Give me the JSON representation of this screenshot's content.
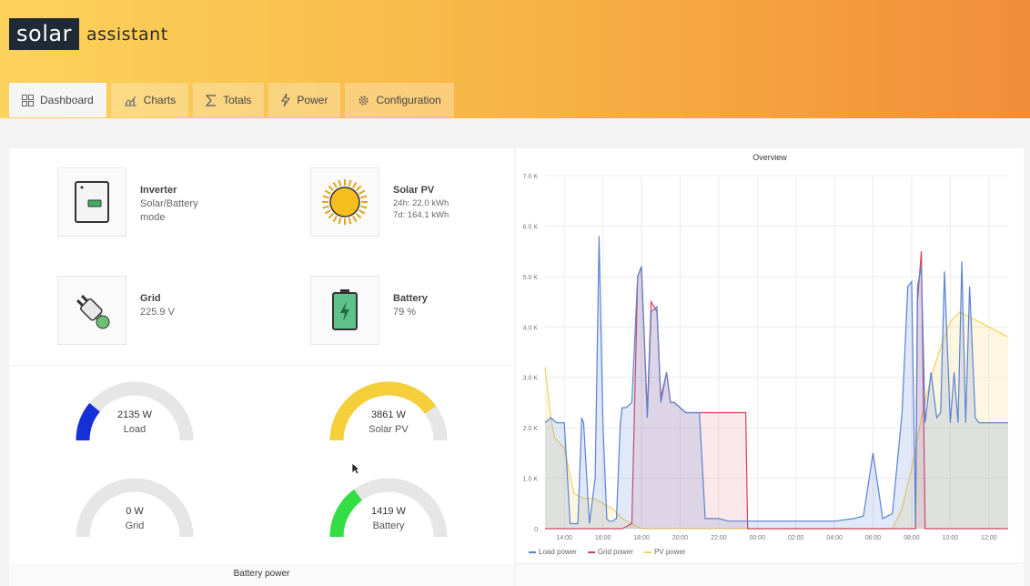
{
  "app": {
    "logo_box": "solar",
    "logo_text": "assistant"
  },
  "tabs": [
    {
      "label": "Dashboard",
      "icon": "grid-icon",
      "active": true
    },
    {
      "label": "Charts",
      "icon": "chart-icon"
    },
    {
      "label": "Totals",
      "icon": "sigma-icon"
    },
    {
      "label": "Power",
      "icon": "bolt-icon"
    },
    {
      "label": "Configuration",
      "icon": "gear-icon"
    }
  ],
  "devices": {
    "inverter": {
      "name": "Inverter",
      "line1": "Solar/Battery",
      "line2": "mode"
    },
    "solar": {
      "name": "Solar PV",
      "line1": "24h: 22.0 kWh",
      "line2": "7d: 164.1 kWh"
    },
    "grid": {
      "name": "Grid",
      "line1": "225.9 V"
    },
    "battery": {
      "name": "Battery",
      "line1": "79 %"
    }
  },
  "gauges": {
    "load": {
      "value": "2135 W",
      "label": "Load",
      "fraction": 0.22,
      "color": "#1530d6"
    },
    "solar": {
      "value": "3861 W",
      "label": "Solar PV",
      "fraction": 0.8,
      "color": "#f4cf3a"
    },
    "grid": {
      "value": "0 W",
      "label": "Grid",
      "fraction": 0.0,
      "color": "#1530d6"
    },
    "battery": {
      "value": "1419 W",
      "label": "Battery",
      "fraction": 0.3,
      "color": "#33dd44"
    }
  },
  "footer": {
    "battery_power_title": "Battery power"
  },
  "colors": {
    "load": "#5a82d0",
    "grid": "#d9405a",
    "pv": "#f2d25e"
  },
  "chart_data": {
    "type": "area",
    "title": "Overview",
    "x_tick_labels": [
      "14:00",
      "16:00",
      "18:00",
      "20:00",
      "22:00",
      "00:00",
      "02:00",
      "04:00",
      "06:00",
      "08:00",
      "10:00",
      "12:00"
    ],
    "y_tick_labels": [
      "0",
      "1.0 K",
      "2.0 K",
      "3.0 K",
      "4.0 K",
      "5.0 K",
      "6.0 K",
      "7.0 K"
    ],
    "ylim": [
      0,
      7000
    ],
    "xlim_hours": [
      13.0,
      37.0
    ],
    "legend": [
      "Load power",
      "Grid power",
      "PV power"
    ],
    "legend_position": "bottom-left",
    "grid": true,
    "series": [
      {
        "name": "Load power",
        "x": [
          13.0,
          13.3,
          13.6,
          14.0,
          14.3,
          14.5,
          14.7,
          14.9,
          15.0,
          15.3,
          15.6,
          15.8,
          16.0,
          16.2,
          16.3,
          16.5,
          16.7,
          16.9,
          17.0,
          17.2,
          17.5,
          17.8,
          18.0,
          18.3,
          18.5,
          18.8,
          19.0,
          19.3,
          19.5,
          19.7,
          20.0,
          20.3,
          20.6,
          21.0,
          21.3,
          21.6,
          22.0,
          22.5,
          23.0,
          23.4,
          23.5,
          24.0,
          25.0,
          26.0,
          27.0,
          28.0,
          29.0,
          29.5,
          30.0,
          30.5,
          31.0,
          31.5,
          31.8,
          32.0,
          32.2,
          32.3,
          32.5,
          32.7,
          33.0,
          33.3,
          33.5,
          33.7,
          34.0,
          34.2,
          34.4,
          34.6,
          34.8,
          35.0,
          35.3,
          35.5,
          35.8,
          36.0,
          36.3,
          36.5,
          36.7,
          37.0
        ],
        "y": [
          2100,
          2200,
          2100,
          2100,
          100,
          100,
          100,
          2200,
          2100,
          100,
          1000,
          5800,
          2100,
          200,
          150,
          150,
          200,
          2100,
          2400,
          2400,
          2500,
          5000,
          5200,
          2200,
          4300,
          4400,
          2500,
          3100,
          2500,
          2500,
          2400,
          2300,
          2300,
          2300,
          200,
          200,
          200,
          150,
          150,
          150,
          150,
          150,
          150,
          150,
          150,
          150,
          200,
          250,
          1500,
          200,
          300,
          2300,
          4800,
          4900,
          100,
          4800,
          5200,
          2100,
          3100,
          2200,
          2300,
          5100,
          2100,
          3100,
          2100,
          5300,
          2100,
          4800,
          2200,
          2100,
          2100,
          2100,
          2100,
          2100,
          2100,
          2100
        ]
      },
      {
        "name": "Grid power",
        "x": [
          13.0,
          14.0,
          16.0,
          17.0,
          17.5,
          17.8,
          18.0,
          18.3,
          18.5,
          18.8,
          19.0,
          19.3,
          19.5,
          19.7,
          20.0,
          20.3,
          20.6,
          21.0,
          21.3,
          21.6,
          22.0,
          22.5,
          23.0,
          23.4,
          23.5,
          24.0,
          30.0,
          31.0,
          32.0,
          32.2,
          32.3,
          32.5,
          32.7,
          37.0
        ],
        "y": [
          0,
          0,
          0,
          0,
          100,
          5000,
          5200,
          2300,
          4500,
          4300,
          2600,
          3100,
          2500,
          2500,
          2400,
          2300,
          2300,
          2300,
          2300,
          2300,
          2300,
          2300,
          2300,
          2300,
          0,
          0,
          0,
          0,
          0,
          0,
          4500,
          5500,
          0,
          0
        ]
      },
      {
        "name": "PV power",
        "x": [
          13.0,
          13.3,
          13.5,
          14.0,
          14.5,
          15.0,
          15.5,
          16.0,
          16.5,
          17.0,
          17.5,
          18.0,
          20.0,
          24.0,
          28.0,
          31.0,
          31.5,
          32.0,
          32.5,
          33.0,
          33.5,
          34.0,
          34.5,
          35.0,
          35.5,
          36.0,
          36.5,
          37.0
        ],
        "y": [
          3200,
          2200,
          1800,
          1600,
          700,
          600,
          600,
          500,
          400,
          200,
          100,
          0,
          0,
          0,
          0,
          0,
          400,
          1200,
          2200,
          3000,
          3600,
          4100,
          4300,
          4200,
          4100,
          4000,
          3900,
          3800
        ]
      }
    ]
  }
}
